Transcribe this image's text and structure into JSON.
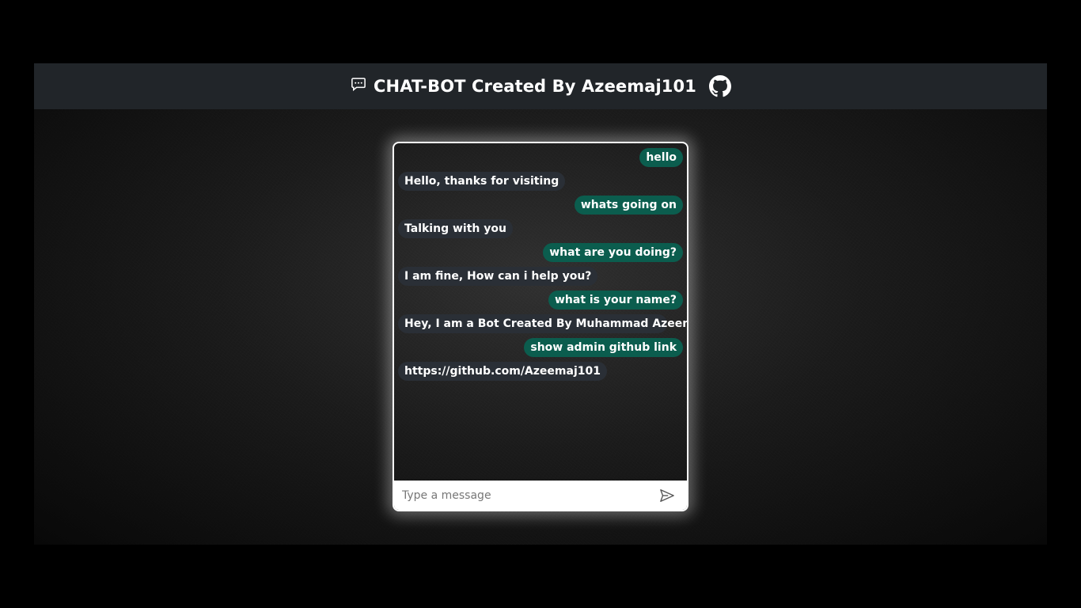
{
  "header": {
    "title": "CHAT-BOT Created By Azeemaj101",
    "chat_icon": "chat-dots-icon",
    "github_icon": "github-icon"
  },
  "chat": {
    "messages": [
      {
        "sender": "user",
        "text": "hello"
      },
      {
        "sender": "bot",
        "text": "Hello, thanks for visiting"
      },
      {
        "sender": "user",
        "text": "whats going on"
      },
      {
        "sender": "bot",
        "text": "Talking with you"
      },
      {
        "sender": "user",
        "text": "what are you doing?"
      },
      {
        "sender": "bot",
        "text": "I am fine, How can i help you?"
      },
      {
        "sender": "user",
        "text": "what is your name?"
      },
      {
        "sender": "bot",
        "text": "Hey, I am a Bot Created By Muhammad Azeem"
      },
      {
        "sender": "user",
        "text": "show admin github link"
      },
      {
        "sender": "bot",
        "text": "https://github.com/Azeemaj101"
      }
    ],
    "input": {
      "placeholder": "Type a message",
      "value": ""
    },
    "send_icon": "send-icon"
  },
  "colors": {
    "navbar": "#212529",
    "user_bubble": "#0b5d4e",
    "bot_bubble": "#2a2f36",
    "page_background": "#000000"
  }
}
